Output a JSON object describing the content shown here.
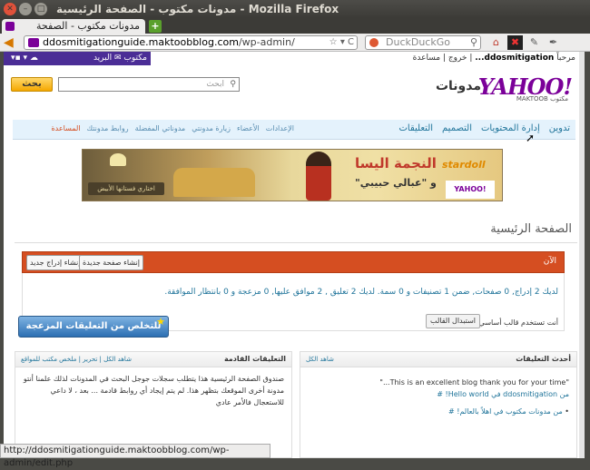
{
  "window": {
    "title": "مدونات مكتوب - الصفحة الرئيسية - Mozilla Firefox",
    "controls": [
      "✕",
      "–",
      "□"
    ]
  },
  "tabs": [
    {
      "label": "مدونات مكتوب - الصفحة الرئيسية"
    }
  ],
  "newtab": "+",
  "nav": {
    "url_domain": "ddosmitigationguide.maktoobblog.com",
    "url_path": "/wp-admin/",
    "url_tools": "☆ ▾ C",
    "search_placeholder": "DuckDuckGo",
    "back": "◀"
  },
  "yahoo_bar": {
    "brand": "مكتوب",
    "mail": "البريد"
  },
  "user": {
    "greeting": "مرحباً",
    "name": "ddosmitigation...",
    "logout": "خروج",
    "help": "مساعدة"
  },
  "search": {
    "placeholder": "ابحث",
    "button": "بحث"
  },
  "logo": {
    "yahoo": "YAHOO!",
    "maktoob": "MAKTOOB مكتوب",
    "blogs": "مدونات"
  },
  "menu": {
    "right": [
      "تدوين",
      "إدارة المحتويات",
      "التصميم",
      "التعليقات"
    ],
    "left": [
      "الإعدادات",
      "الأعضاء",
      "زيارة مدونتي",
      "مدوناتي المفضلة",
      "روابط مدونتك",
      "المساعدة"
    ]
  },
  "banner": {
    "star_line": "النجمة اليسا",
    "song": "و \"عبالي حبيبي\"",
    "choose": "اختاري فستانها الأبيض",
    "stardoll": "stardoll",
    "yahoo_badge": "YAHOO! مكتوب"
  },
  "page_title": "الصفحة الرئيسية",
  "now_bar": {
    "now_label": "الآن",
    "new_page": "إنشاء صفحة جديدة",
    "new_post": "إنشاء إدراج جديد"
  },
  "stats": {
    "line": "لديك 2 إدراج, 0 صفحات, ضمن 1 تصنيفات و 0 سمة. لديك 2 تعليق , 2 موافق عليها, 0 مزعجة و 0 بانتظار الموافقة.",
    "theme": "أنت تستخدم قالب أساسي مع 7 صندوق.",
    "change_theme": "استبدال القالب"
  },
  "promo": {
    "label": "للتخلص من التعليقات المزعجة انقرهنا"
  },
  "comments_panel": {
    "title": "أحدث التعليقات",
    "see_all": "شاهد الكل",
    "quote": "\"This is an excellent blog thank you for your time...\"",
    "from": "من ddosmitigation في Hello world! #",
    "more": "من مدونات مكتوب في اهلاً بالعالم! #"
  },
  "drafts_panel": {
    "title": "التعليقات القادمة",
    "links": "شاهد الكل | تحرير | ملخص مكتب للمواقع",
    "text": "صندوق الصفحة الرئيسية هذا يتطلب سجلات جوجل البحث في المدونات لذلك علمنا أنتو مدونة أخرى الموقعك بتظهر هذا. لم يتم إيجاد أي روابط قادمة ... بعد ، لا داعي للاستعجال فالأمر عادي"
  },
  "statusbar": {
    "url": "http://ddosmitigationguide.maktoobblog.com/wp-admin/edit.php"
  },
  "colors": {
    "wp_orange": "#d54e21",
    "yahoo_purple": "#7b0099",
    "link_blue": "#21759b",
    "menu_bg": "#e4f2fc"
  }
}
